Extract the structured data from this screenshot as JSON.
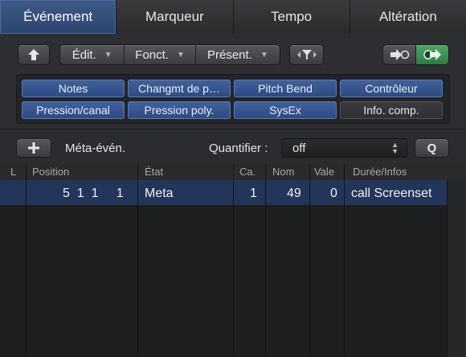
{
  "tabs": [
    {
      "label": "Événement",
      "active": true
    },
    {
      "label": "Marqueur",
      "active": false
    },
    {
      "label": "Tempo",
      "active": false
    },
    {
      "label": "Altération",
      "active": false
    }
  ],
  "toolbar": {
    "edit_label": "Édit.",
    "functions_label": "Fonct.",
    "view_label": "Présent.",
    "up_icon": "arrow-up-icon",
    "filter_icon": "filter-icon",
    "midi_in_icon": "midi-in-icon",
    "midi_out_icon": "midi-out-icon"
  },
  "filters": [
    {
      "label": "Notes",
      "on": true
    },
    {
      "label": "Changmt de p…",
      "on": true
    },
    {
      "label": "Pitch Bend",
      "on": true
    },
    {
      "label": "Contrôleur",
      "on": true
    },
    {
      "label": "Pression/canal",
      "on": true
    },
    {
      "label": "Pression poly.",
      "on": true
    },
    {
      "label": "SysEx",
      "on": true
    },
    {
      "label": "Info. comp.",
      "on": false
    }
  ],
  "listbar": {
    "add_icon": "plus-icon",
    "type_label": "Méta-évén.",
    "quantize_label": "Quantifier :",
    "quantize_value": "off",
    "q_label": "Q"
  },
  "table": {
    "headers": [
      "L",
      "Position",
      "État",
      "Ca.",
      "Nom",
      "Vale",
      "Durée/Infos"
    ],
    "rows": [
      {
        "position": "5  1  1     1",
        "status": "Meta",
        "channel": "1",
        "number": "49",
        "value": "0",
        "info": "call Screenset"
      }
    ]
  },
  "colors": {
    "accent": "#2c4470",
    "selected_row": "#23355a",
    "filter_on": "#2e4b82"
  }
}
